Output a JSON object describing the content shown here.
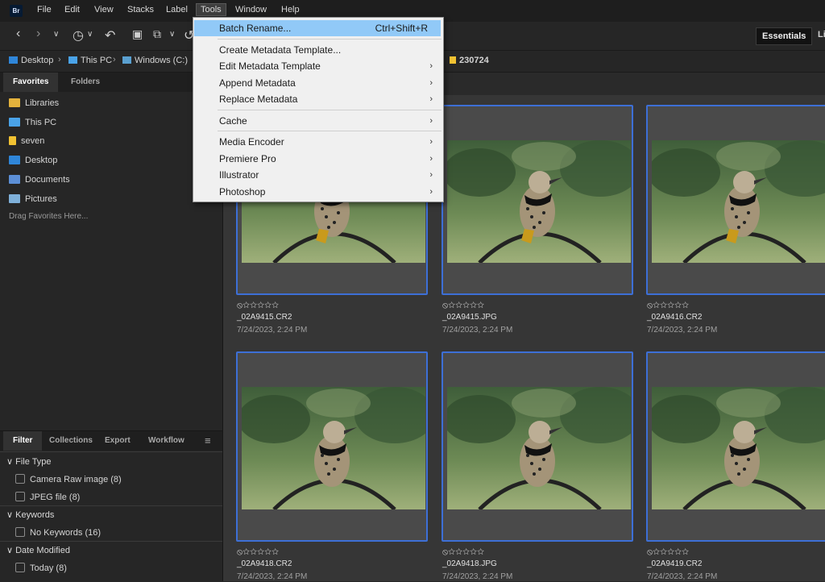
{
  "app": {
    "logo": "Br"
  },
  "menubar": [
    "File",
    "Edit",
    "View",
    "Stacks",
    "Label",
    "Tools",
    "Window",
    "Help"
  ],
  "toolbar": {
    "icons": [
      "back-arrow-icon",
      "forward-arrow-icon",
      "chevron-down-icon",
      "history-icon",
      "chevron-down-icon",
      "boomerang-icon",
      "camera-icon",
      "copy-icon",
      "chevron-down-icon",
      "rotate-icon"
    ],
    "workspace_active": "Essentials",
    "workspace_next": "Li"
  },
  "path": {
    "crumbs": [
      "Desktop",
      "This PC",
      "Windows (C:)"
    ],
    "folder": "230724"
  },
  "left_tabs": [
    "Favorites",
    "Folders"
  ],
  "favorites": [
    {
      "label": "Libraries",
      "icon": "libraries-icon",
      "color": "#e3b23c"
    },
    {
      "label": "This PC",
      "icon": "computer-icon",
      "color": "#4aa3e8"
    },
    {
      "label": "seven",
      "icon": "folder-icon",
      "color": "#f1c232"
    },
    {
      "label": "Desktop",
      "icon": "desktop-icon",
      "color": "#2f86d9"
    },
    {
      "label": "Documents",
      "icon": "documents-icon",
      "color": "#5c8fd6"
    },
    {
      "label": "Pictures",
      "icon": "pictures-icon",
      "color": "#7fb0d9"
    }
  ],
  "drag_hint": "Drag Favorites Here...",
  "filter_tabs": [
    "Filter",
    "Collections",
    "Export",
    "Workflow"
  ],
  "filters": [
    {
      "title": "File Type",
      "items": [
        "Camera Raw image (8)",
        "JPEG file (8)"
      ]
    },
    {
      "title": "Keywords",
      "items": [
        "No Keywords (16)"
      ]
    },
    {
      "title": "Date Modified",
      "items": [
        "Today (8)"
      ]
    }
  ],
  "thumbnails": [
    {
      "name": "_02A9415.CR2",
      "date": "7/24/2023, 2:24 PM",
      "rating": "⦸☆☆☆☆☆"
    },
    {
      "name": "_02A9415.JPG",
      "date": "7/24/2023, 2:24 PM",
      "rating": "⦸☆☆☆☆☆"
    },
    {
      "name": "_02A9416.CR2",
      "date": "7/24/2023, 2:24 PM",
      "rating": "⦸☆☆☆☆☆"
    },
    {
      "name": "_02A9418.CR2",
      "date": "7/24/2023, 2:24 PM",
      "rating": "⦸☆☆☆☆☆"
    },
    {
      "name": "_02A9418.JPG",
      "date": "7/24/2023, 2:24 PM",
      "rating": "⦸☆☆☆☆☆"
    },
    {
      "name": "_02A9419.CR2",
      "date": "7/24/2023, 2:24 PM",
      "rating": "⦸☆☆☆☆☆"
    }
  ],
  "tools_menu": {
    "items": [
      {
        "label": "Batch Rename...",
        "shortcut": "Ctrl+Shift+R",
        "submenu": false,
        "highlighted": true
      },
      {
        "separator": true
      },
      {
        "label": "Create Metadata Template...",
        "submenu": false
      },
      {
        "label": "Edit Metadata Template",
        "submenu": true
      },
      {
        "label": "Append Metadata",
        "submenu": true
      },
      {
        "label": "Replace Metadata",
        "submenu": true
      },
      {
        "separator": true
      },
      {
        "label": "Cache",
        "submenu": true
      },
      {
        "separator": true
      },
      {
        "label": "Media Encoder",
        "submenu": true
      },
      {
        "label": "Premiere Pro",
        "submenu": true
      },
      {
        "label": "Illustrator",
        "submenu": true
      },
      {
        "label": "Photoshop",
        "submenu": true
      }
    ]
  },
  "colors": {
    "selection_border": "#3d6fd6",
    "menu_highlight": "#91c9f7"
  }
}
